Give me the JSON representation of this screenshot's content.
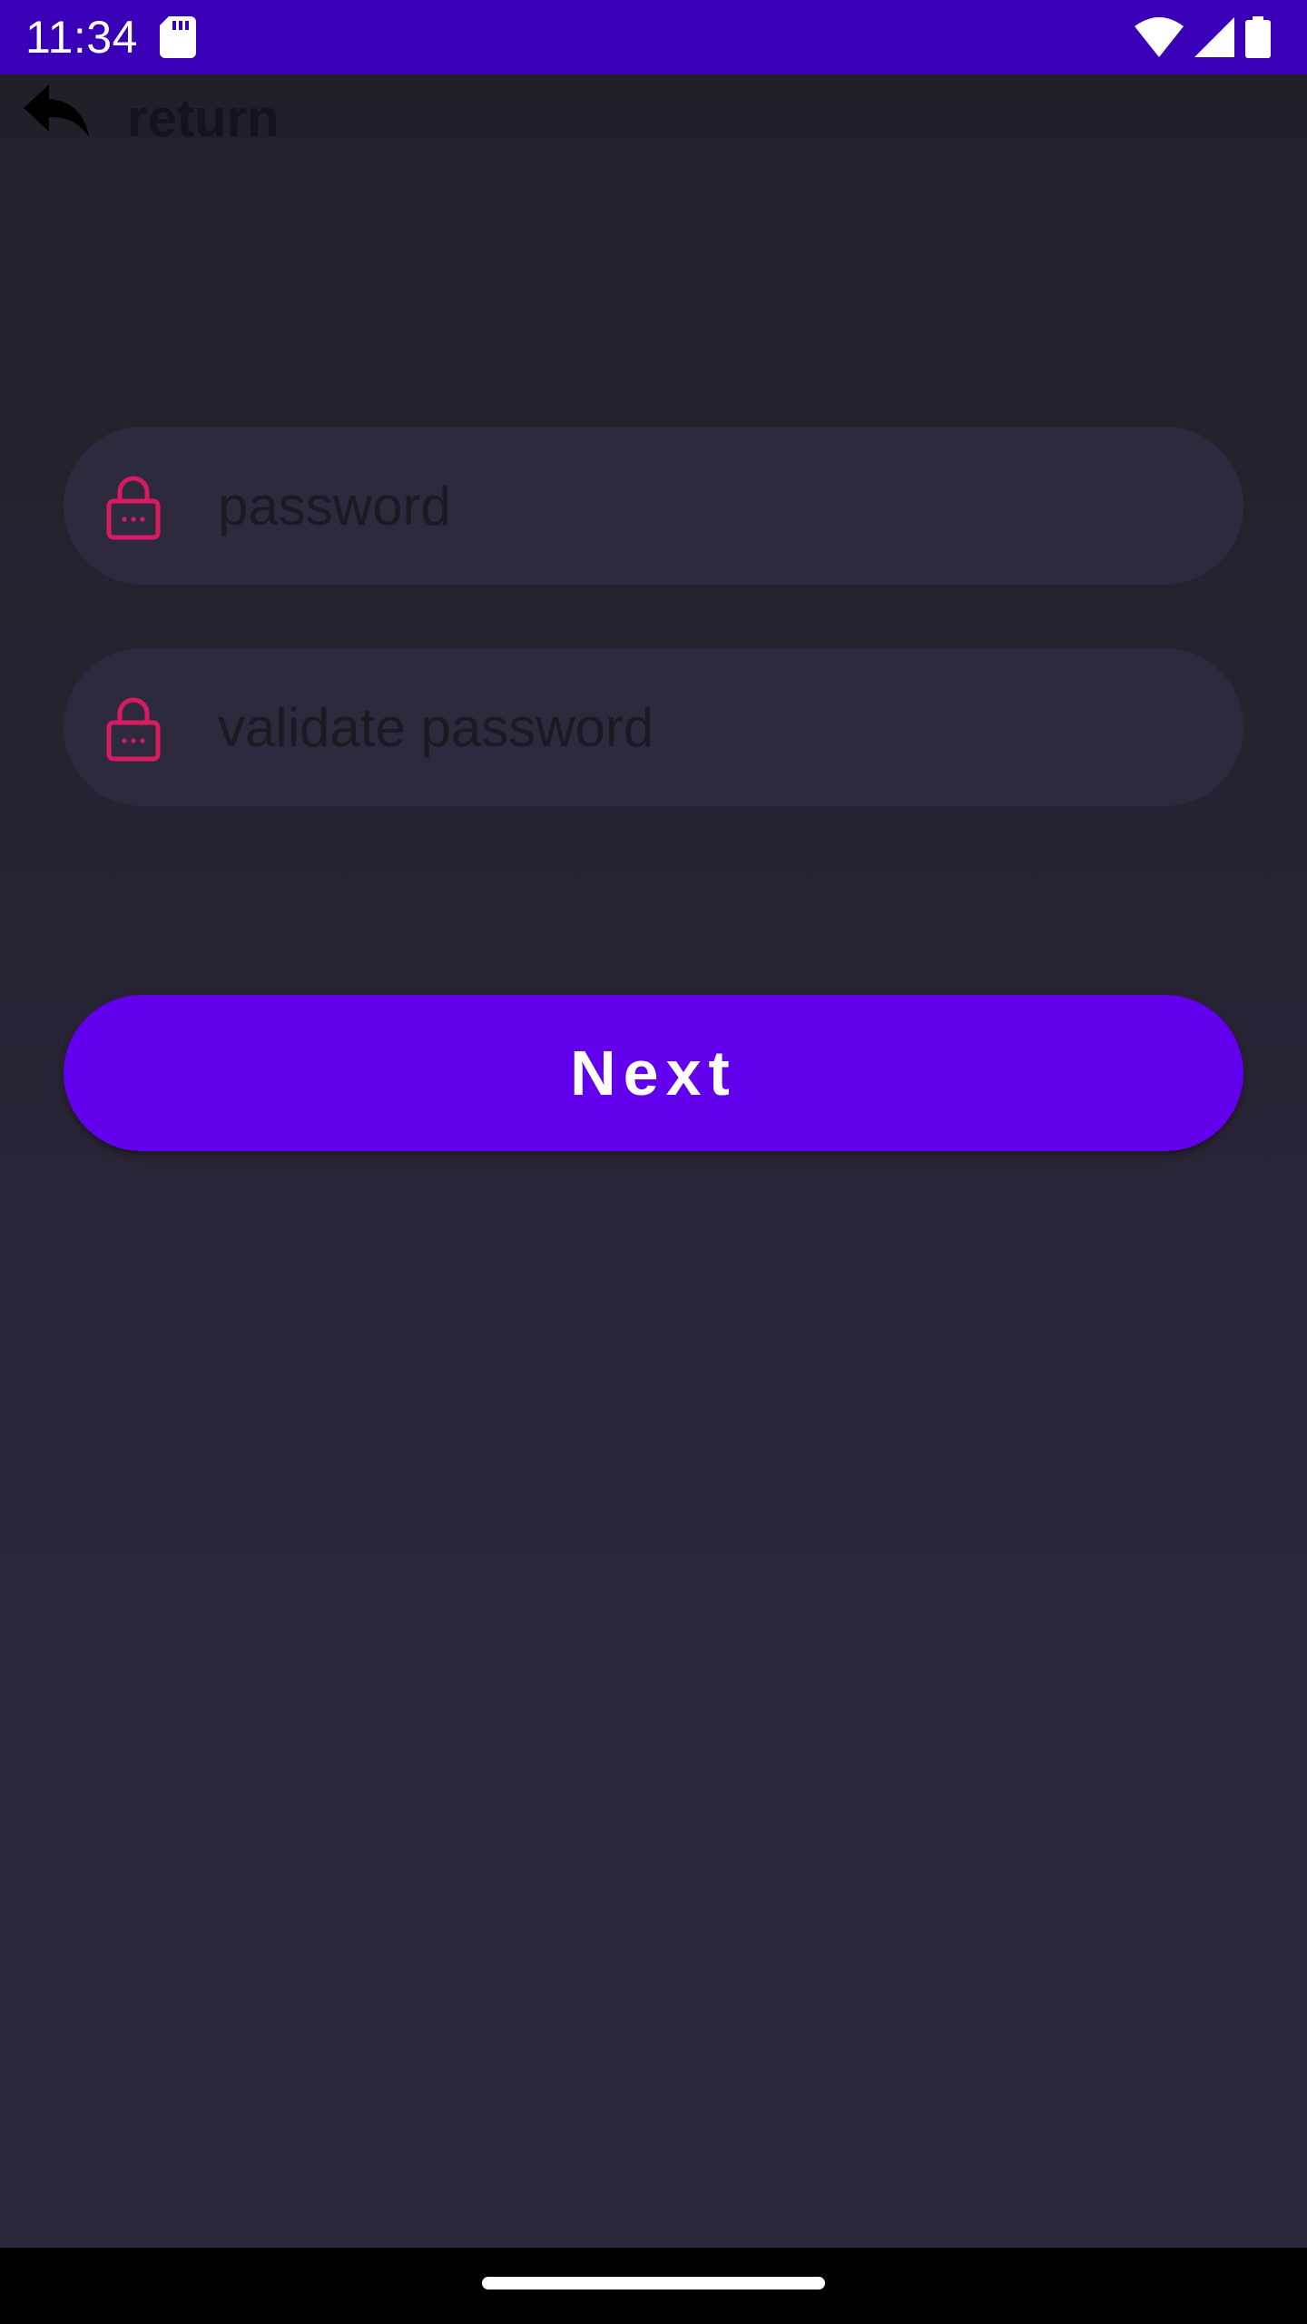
{
  "status_bar": {
    "time": "11:34",
    "background_color": "#3A00B8",
    "icons": [
      "sd-card-icon",
      "wifi-icon",
      "cellular-signal-icon",
      "battery-icon"
    ]
  },
  "top_bar": {
    "back_icon": "reply-arrow-icon",
    "return_label": "return"
  },
  "form": {
    "password": {
      "placeholder": "password",
      "value": "",
      "icon": "lock-icon"
    },
    "validate_password": {
      "placeholder": "validate password",
      "value": "",
      "icon": "lock-icon"
    }
  },
  "next_button": {
    "label": "Next"
  },
  "colors": {
    "accent": "#6200EE",
    "lock_icon": "#D81B60",
    "field_background": "#2D2A3E",
    "screen_background": "#221F28"
  }
}
